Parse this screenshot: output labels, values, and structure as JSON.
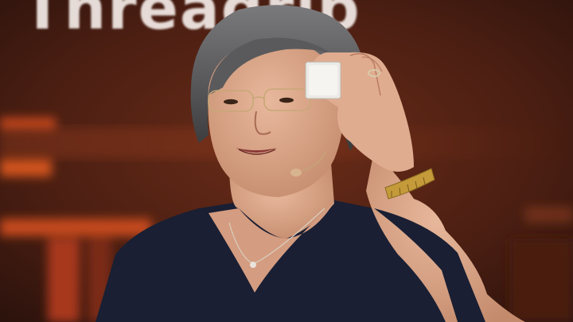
{
  "photo": {
    "background_sign": {
      "text": "Threadrip",
      "colors": {
        "sign_text": "#f4ece8",
        "stage_backdrop": "#5a2414",
        "stage_glow": "#c4461c"
      }
    },
    "subject": {
      "held_object": "processor-chip",
      "colors": {
        "hair": "#4a4a4c",
        "skin": "#d9a58a",
        "top": "#1a1f33",
        "chip": "#eceae6",
        "bracelet": "#c49a3a"
      }
    }
  }
}
